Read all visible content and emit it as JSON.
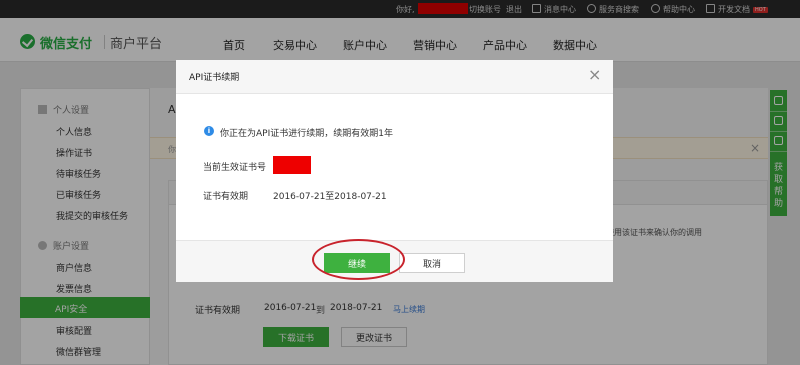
{
  "topbar": {
    "greeting": "你好,",
    "switch_account": "切换账号",
    "logout": "退出",
    "message_center": "消息中心",
    "service_search": "服务商搜索",
    "help_center": "帮助中心",
    "dev_docs": "开发文档",
    "hot_badge": "HOT"
  },
  "header": {
    "logo_text": "微信支付",
    "logo_subtitle": "商户平台",
    "nav": [
      "首页",
      "交易中心",
      "账户中心",
      "营销中心",
      "产品中心",
      "数据中心"
    ]
  },
  "sidebar": {
    "group_personal": "个人设置",
    "personal_items": [
      "个人信息",
      "操作证书",
      "待审核任务",
      "已审核任务",
      "我提交的审核任务"
    ],
    "group_account": "账户设置",
    "account_items": [
      "商户信息",
      "发票信息",
      "API安全",
      "审核配置",
      "微信群管理"
    ],
    "active": "API安全"
  },
  "content": {
    "title_fragment": "A",
    "notice_fragment": "你",
    "notice_close": "×",
    "card_fragment": "使用该证书来确认你的调用",
    "cert_label": "证书有效期",
    "cert_from": "2016-07-21",
    "cert_to_sep": "到",
    "cert_end": "2018-07-21",
    "renew_link": "马上续期",
    "download_btn": "下载证书",
    "change_btn": "更改证书"
  },
  "float_tool": {
    "text": "获取帮助"
  },
  "modal": {
    "title": "API证书续期",
    "close": "×",
    "info_icon": "i",
    "info_text": "你正在为API证书进行续期，续期有效期1年",
    "cert_no_label": "当前生效证书号",
    "validity_label": "证书有效期",
    "validity_value": "2016-07-21至2018-07-21",
    "continue_btn": "继续",
    "cancel_btn": "取消"
  },
  "colors": {
    "brand_green": "#3eb13f",
    "topbar_bg": "#2b2b2b",
    "redaction_red": "#ee0000",
    "annotation_red": "#c8232c",
    "info_blue": "#2e8be6"
  }
}
